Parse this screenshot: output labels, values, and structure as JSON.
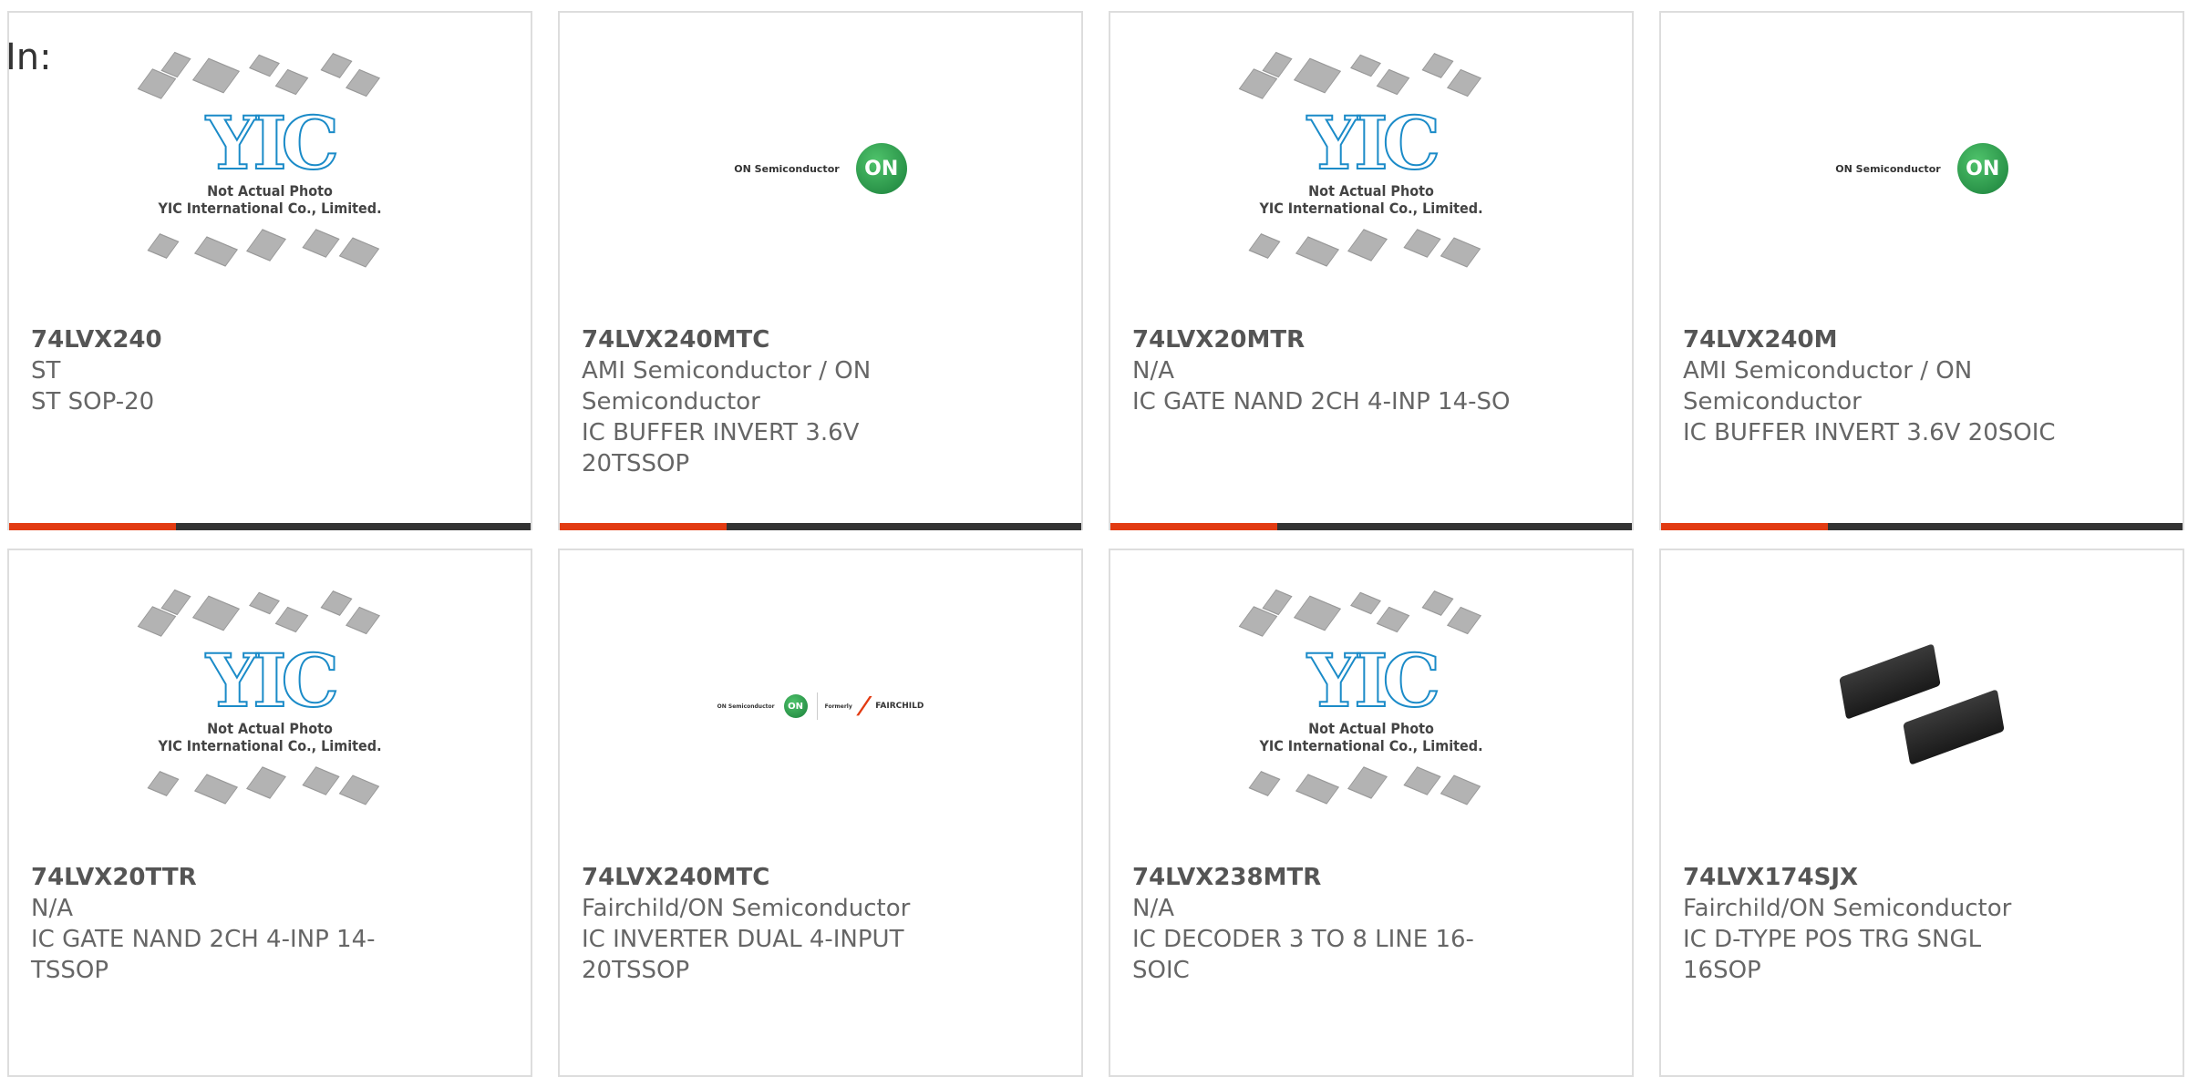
{
  "header": {
    "in_label": "In:"
  },
  "placeholder": {
    "caption_line1": "Not Actual Photo",
    "caption_line2": "YIC International Co., Limited.",
    "logo_text": "YIC"
  },
  "logos": {
    "on_semi_text": "ON Semiconductor",
    "on_mark": "ON",
    "formerly": "Formerly",
    "fairchild": "FAIRCHILD"
  },
  "colors": {
    "accent": "#e23b12",
    "bar": "#333333",
    "border": "#dddddd",
    "yic_blue": "#1b8bc8",
    "on_green": "#2e9b4a"
  },
  "products": [
    {
      "part": "74LVX240",
      "manufacturer": "ST",
      "description": "ST SOP-20",
      "image": "yic-placeholder"
    },
    {
      "part": "74LVX240MTC",
      "manufacturer": "AMI Semiconductor / ON Semiconductor",
      "description": "IC BUFFER INVERT 3.6V 20TSSOP",
      "image": "on-semiconductor-logo"
    },
    {
      "part": "74LVX20MTR",
      "manufacturer": "N/A",
      "description": "IC GATE NAND 2CH 4-INP 14-SO",
      "image": "yic-placeholder"
    },
    {
      "part": "74LVX240M",
      "manufacturer": "AMI Semiconductor / ON Semiconductor",
      "description": "IC BUFFER INVERT 3.6V 20SOIC",
      "image": "on-semiconductor-logo"
    },
    {
      "part": "74LVX20TTR",
      "manufacturer": "N/A",
      "description": "IC GATE NAND 2CH 4-INP 14-TSSOP",
      "image": "yic-placeholder"
    },
    {
      "part": "74LVX240MTC",
      "manufacturer": "Fairchild/ON Semiconductor",
      "description": "IC INVERTER DUAL 4-INPUT 20TSSOP",
      "image": "on-fairchild-logo"
    },
    {
      "part": "74LVX238MTR",
      "manufacturer": "N/A",
      "description": "IC DECODER 3 TO 8 LINE 16-SOIC",
      "image": "yic-placeholder"
    },
    {
      "part": "74LVX174SJX",
      "manufacturer": "Fairchild/ON Semiconductor",
      "description": "IC D-TYPE POS TRG SNGL 16SOP",
      "image": "ic-chip-photo"
    }
  ]
}
